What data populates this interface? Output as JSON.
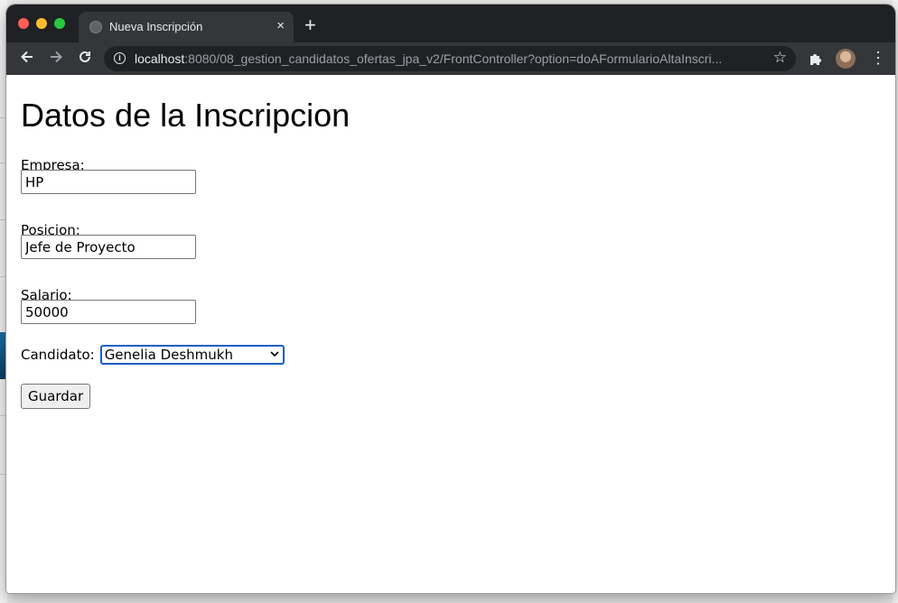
{
  "browser": {
    "tab_title": "Nueva Inscripción",
    "tab_close": "×",
    "new_tab": "+",
    "url_host": "localhost",
    "url_rest": ":8080/08_gestion_candidatos_ofertas_jpa_v2/FrontController?option=doAFormularioAltaInscri...",
    "icons": {
      "back": "arrow-left-icon",
      "forward": "arrow-right-icon",
      "reload": "reload-icon",
      "info": "info-icon",
      "star": "star-icon",
      "extensions": "puzzle-icon",
      "menu": "kebab-menu-icon"
    }
  },
  "form": {
    "title": "Datos de la Inscripcion",
    "empresa_label": "Empresa:",
    "empresa_value": "HP",
    "posicion_label": "Posicion:",
    "posicion_value": "Jefe de Proyecto",
    "salario_label": "Salario:",
    "salario_value": "50000",
    "candidato_label": "Candidato:",
    "candidato_selected": "Genelia Deshmukh",
    "submit_label": "Guardar"
  },
  "colors": {
    "chrome_dark": "#202124",
    "chrome_toolbar": "#35363a",
    "focus_blue": "#1a5fc4"
  }
}
